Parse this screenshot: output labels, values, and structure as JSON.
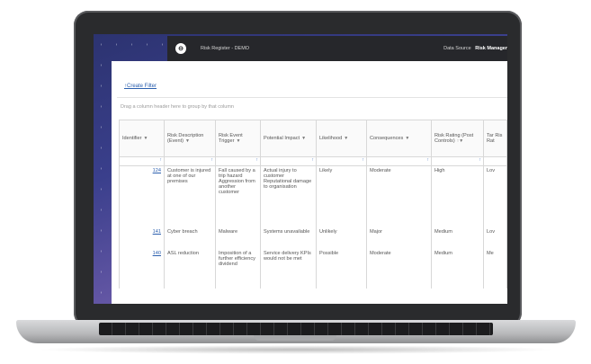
{
  "topbar": {
    "title": "Risk Register - DEMO",
    "data_source_label": "Data Source",
    "data_source_value": "Risk Manager",
    "logo_glyph": "⊖"
  },
  "filter": {
    "create_label": "Create Filter",
    "hint": "Drag a column header here to group by that column"
  },
  "columns": [
    "Identifier",
    "Risk Description (Event)",
    "Risk Event Trigger",
    "Potential Impact",
    "Likelihood",
    "Consequences",
    "Risk Rating (Post Controls)",
    "Tar Ris Rat"
  ],
  "rows": [
    [
      "124",
      "Customer is injured at one of our premises",
      "Fall caused by a trip hazard Aggression from another customer",
      "Actual injury to customer Reputational damage to organisation",
      "Likely",
      "Moderate",
      "High",
      "Lov"
    ],
    [
      "141",
      "Cyber breach",
      "Malware",
      "Systems unavailable",
      "Unlikely",
      "Major",
      "Medium",
      "Lov"
    ],
    [
      "140",
      "ASL reduction",
      "Imposition of a further efficiency dividend",
      "Service delivery KPIs would not be met",
      "Possible",
      "Moderate",
      "Medium",
      "Me"
    ]
  ]
}
